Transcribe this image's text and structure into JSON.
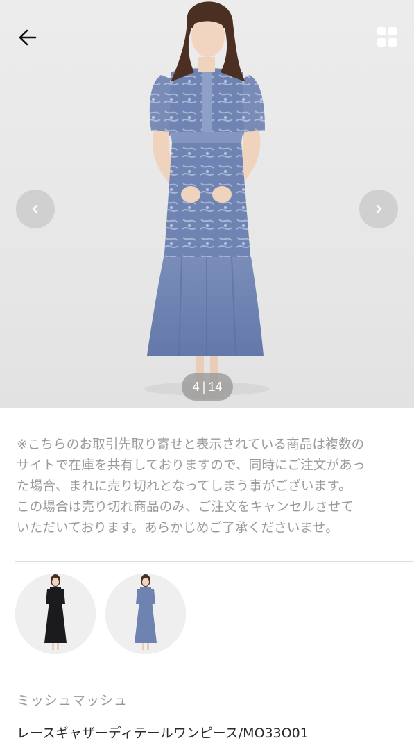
{
  "gallery": {
    "current": "4",
    "separator": "|",
    "total": "14",
    "icons": {
      "back": "arrow-left-icon",
      "grid": "grid-icon",
      "prev": "chevron-left-icon",
      "next": "chevron-right-icon"
    }
  },
  "notice": {
    "lines": [
      "※こちらのお取引先取り寄せと表示されている商品は複数の",
      "サイトで在庫を共有しておりますので、同時にご注文があっ",
      "た場合、まれに売り切れとなってしまう事がございます。",
      "この場合は売り切れ商品のみ、ご注文をキャンセルさせて",
      "いただいております。あらかじめご了承くださいませ。"
    ]
  },
  "colors": {
    "options": [
      {
        "name": "black",
        "swatch": "#1b1b1d"
      },
      {
        "name": "blue",
        "swatch": "#6f83b1"
      }
    ],
    "dress_main": "#7186b5"
  },
  "product": {
    "brand": "ミッシュマッシュ",
    "name": "レースギャザーディテールワンピース/MO33O01"
  }
}
